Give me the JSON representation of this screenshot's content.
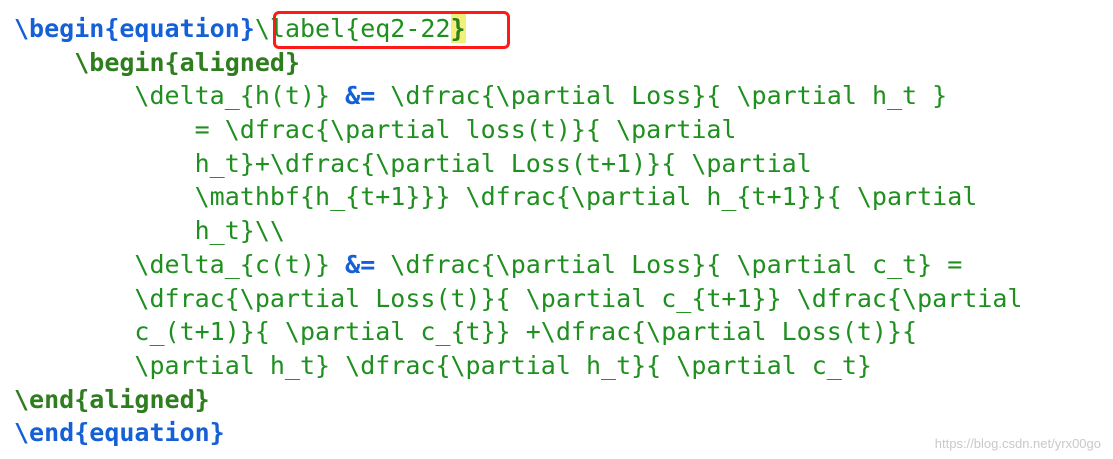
{
  "editor": {
    "lines": [
      {
        "indent": "",
        "parts": [
          {
            "t": "\\begin",
            "c": "kw-blue"
          },
          {
            "t": "{equation}",
            "c": "brace-blue"
          },
          {
            "t": "\\",
            "c": "green"
          },
          {
            "t": "label{eq2-22",
            "c": "green"
          },
          {
            "t": "}",
            "c": "hl-brace"
          }
        ]
      },
      {
        "indent": "    ",
        "parts": [
          {
            "t": "\\begin",
            "c": "kw-green"
          },
          {
            "t": "{aligned}",
            "c": "kw-green"
          }
        ]
      },
      {
        "indent": "        ",
        "parts": [
          {
            "t": "\\delta_{h(t)} ",
            "c": "green"
          },
          {
            "t": "&=",
            "c": "op-blue"
          },
          {
            "t": " \\dfrac{\\partial Loss}{ \\partial h_t }",
            "c": "green"
          }
        ]
      },
      {
        "indent": "            ",
        "parts": [
          {
            "t": "= \\dfrac{\\partial loss(t)}{ \\partial",
            "c": "green"
          }
        ]
      },
      {
        "indent": "            ",
        "parts": [
          {
            "t": "h_t}+\\dfrac{\\partial Loss(t+1)}{ \\partial",
            "c": "green"
          }
        ]
      },
      {
        "indent": "            ",
        "parts": [
          {
            "t": "\\mathbf{h_{t+1}}} \\dfrac{\\partial h_{t+1}}{ \\partial",
            "c": "green"
          }
        ]
      },
      {
        "indent": "            ",
        "parts": [
          {
            "t": "h_t}\\\\",
            "c": "green"
          }
        ]
      },
      {
        "indent": "        ",
        "parts": [
          {
            "t": "\\delta_{c(t)} ",
            "c": "green"
          },
          {
            "t": "&=",
            "c": "op-blue"
          },
          {
            "t": " \\dfrac{\\partial Loss}{ \\partial c_t} =",
            "c": "green"
          }
        ]
      },
      {
        "indent": "        ",
        "parts": [
          {
            "t": "\\dfrac{\\partial Loss(t)}{ \\partial c_{t+1}} \\dfrac{\\partial",
            "c": "green"
          }
        ]
      },
      {
        "indent": "        ",
        "parts": [
          {
            "t": "c_(t+1)}{ \\partial c_{t}} +\\dfrac{\\partial Loss(t)}{",
            "c": "green"
          }
        ]
      },
      {
        "indent": "        ",
        "parts": [
          {
            "t": "\\partial h_t} \\dfrac{\\partial h_t}{ \\partial c_t}",
            "c": "green"
          }
        ]
      },
      {
        "indent": "",
        "parts": [
          {
            "t": "\\end",
            "c": "kw-green"
          },
          {
            "t": "{aligned}",
            "c": "kw-green"
          }
        ]
      },
      {
        "indent": "",
        "parts": [
          {
            "t": "\\end",
            "c": "kw-blue"
          },
          {
            "t": "{equation}",
            "c": "brace-blue"
          }
        ]
      }
    ]
  },
  "highlight": {
    "label": "label-annotation-box",
    "color": "#ff1a1a"
  },
  "watermark": {
    "text": "https://blog.csdn.net/yrx00go"
  }
}
